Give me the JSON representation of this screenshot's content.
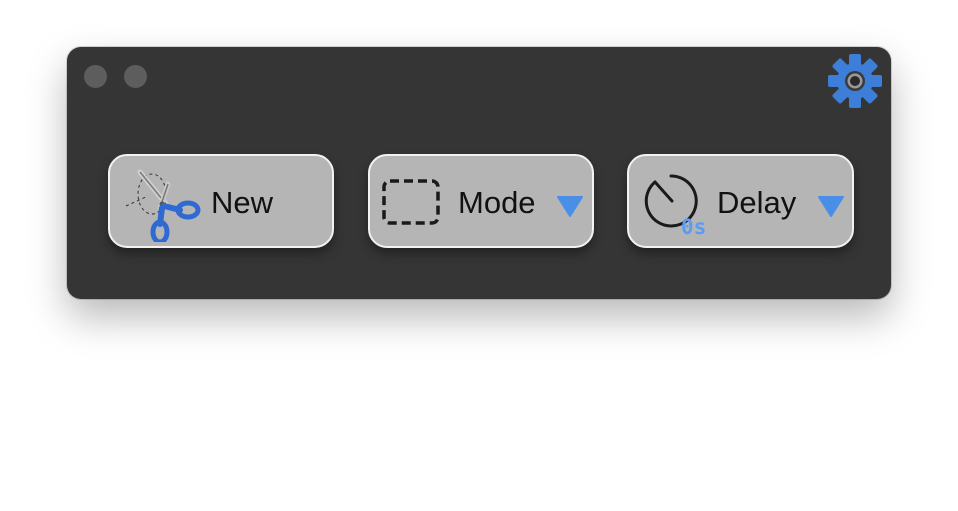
{
  "toolbar": {
    "new": {
      "label": "New",
      "icon": "scissors-icon"
    },
    "mode": {
      "label": "Mode",
      "icon": "dashed-rectangle-icon",
      "caret_icon": "caret-down-icon"
    },
    "delay": {
      "label": "Delay",
      "value": "0s",
      "icon": "timer-icon",
      "caret_icon": "caret-down-icon"
    }
  },
  "settings": {
    "icon": "gear-icon"
  },
  "colors": {
    "window_bg": "#353535",
    "button_bg": "#b5b5b5",
    "accent": "#4a8fe7",
    "traffic_light": "#5d5d5d"
  }
}
